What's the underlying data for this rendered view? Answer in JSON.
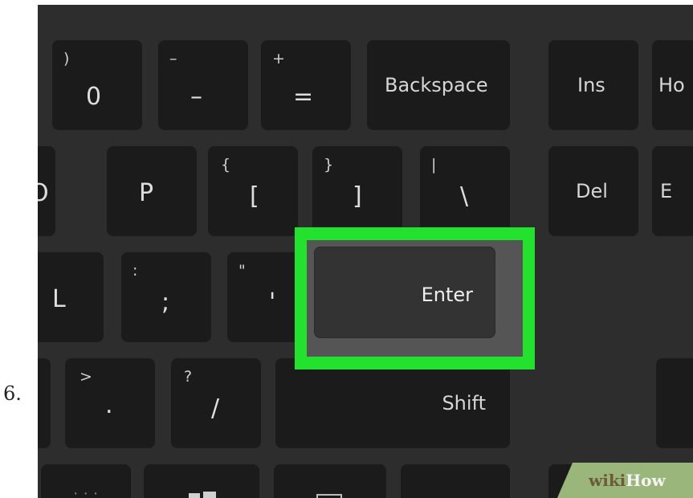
{
  "step": {
    "number": "6."
  },
  "keyboard": {
    "rows": [
      {
        "keys": [
          {
            "main": "0",
            "shifted": ")"
          },
          {
            "main": "–",
            "shifted": "–"
          },
          {
            "main": "=",
            "shifted": "+"
          },
          {
            "word": "Backspace"
          },
          {
            "word": "Ins"
          },
          {
            "word": "Ho"
          }
        ]
      },
      {
        "keys": [
          {
            "main": "O"
          },
          {
            "main": "P"
          },
          {
            "main": "[",
            "shifted": "{"
          },
          {
            "main": "]",
            "shifted": "}"
          },
          {
            "main": "\\",
            "shifted": "|"
          },
          {
            "word": "Del"
          },
          {
            "word": "E"
          }
        ]
      },
      {
        "keys": [
          {
            "main": "L"
          },
          {
            "main": ";",
            "shifted": ":"
          },
          {
            "main": "'",
            "shifted": "\""
          }
        ]
      },
      {
        "keys": [
          {
            "main": ".",
            "shifted": ">"
          },
          {
            "main": "/",
            "shifted": "?"
          },
          {
            "word": "Shift"
          }
        ]
      }
    ],
    "enter": {
      "label": "Enter",
      "highlight_color": "#22e22d"
    }
  },
  "watermark": {
    "wiki": "wiki",
    "how": "How"
  }
}
